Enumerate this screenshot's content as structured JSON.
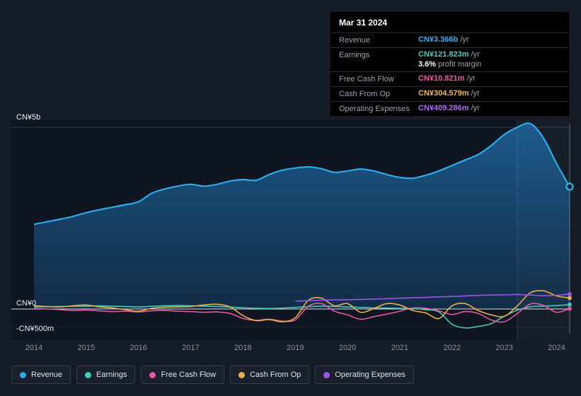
{
  "tooltip": {
    "date": "Mar 31 2024",
    "rows": [
      {
        "label": "Revenue",
        "value": "CN¥3.366b",
        "suffix": "/yr",
        "color": "#3fb1f0"
      },
      {
        "label": "Earnings",
        "value": "CN¥121.823m",
        "suffix": "/yr",
        "color": "#50cabb",
        "extra_value": "3.6%",
        "extra_label": "profit margin"
      },
      {
        "label": "Free Cash Flow",
        "value": "CN¥10.821m",
        "suffix": "/yr",
        "color": "#ea5ba6"
      },
      {
        "label": "Cash From Op",
        "value": "CN¥304.579m",
        "suffix": "/yr",
        "color": "#eebb55"
      },
      {
        "label": "Operating Expenses",
        "value": "CN¥409.286m",
        "suffix": "/yr",
        "color": "#b06cf5"
      }
    ]
  },
  "axes": {
    "y_labels": [
      "CN¥5b",
      "CN¥0",
      "-CN¥500m"
    ]
  },
  "legend": [
    {
      "label": "Revenue",
      "color": "#2fa9e8"
    },
    {
      "label": "Earnings",
      "color": "#45c7b5"
    },
    {
      "label": "Free Cash Flow",
      "color": "#e2579f"
    },
    {
      "label": "Cash From Op",
      "color": "#e6af4b"
    },
    {
      "label": "Operating Expenses",
      "color": "#9b55ea"
    }
  ],
  "chart_data": {
    "type": "area",
    "title": "Company earnings and revenue history",
    "x_unit": "year",
    "y_unit": "CN¥ millions",
    "x_range": [
      2014,
      2024.25
    ],
    "ylim": [
      -700,
      5400
    ],
    "grid": "horizontal",
    "legend_position": "bottom-left",
    "x_ticks": [
      2014,
      2015,
      2016,
      2017,
      2018,
      2019,
      2020,
      2021,
      2022,
      2023,
      2024
    ],
    "y_ticks": [
      {
        "label": "CN¥5b",
        "value": 5000
      },
      {
        "label": "CN¥0",
        "value": 0
      },
      {
        "label": "-CN¥500m",
        "value": -500
      }
    ],
    "x": [
      2014,
      2014.25,
      2014.5,
      2014.75,
      2015,
      2015.25,
      2015.5,
      2015.75,
      2016,
      2016.25,
      2016.5,
      2016.75,
      2017,
      2017.25,
      2017.5,
      2017.75,
      2018,
      2018.25,
      2018.5,
      2018.75,
      2019,
      2019.25,
      2019.5,
      2019.75,
      2020,
      2020.25,
      2020.5,
      2020.75,
      2021,
      2021.25,
      2021.5,
      2021.75,
      2022,
      2022.25,
      2022.5,
      2022.75,
      2023,
      2023.25,
      2023.5,
      2023.75,
      2024,
      2024.25
    ],
    "series": [
      {
        "name": "Revenue",
        "key": "revenue",
        "color": "#2fa9e8",
        "fill": true,
        "y": [
          2330,
          2400,
          2470,
          2550,
          2650,
          2730,
          2800,
          2870,
          2950,
          3180,
          3300,
          3380,
          3430,
          3380,
          3430,
          3520,
          3560,
          3540,
          3700,
          3820,
          3880,
          3910,
          3860,
          3760,
          3800,
          3850,
          3800,
          3700,
          3620,
          3600,
          3680,
          3800,
          3950,
          4100,
          4250,
          4500,
          4800,
          5000,
          5100,
          4700,
          4000,
          3366
        ]
      },
      {
        "name": "Earnings",
        "key": "earnings",
        "color": "#45c7b5",
        "fill": false,
        "y": [
          60,
          65,
          70,
          75,
          80,
          85,
          80,
          70,
          60,
          75,
          90,
          95,
          90,
          80,
          70,
          55,
          35,
          20,
          15,
          25,
          45,
          65,
          80,
          70,
          60,
          45,
          30,
          25,
          20,
          10,
          -20,
          -80,
          -420,
          -520,
          -480,
          -400,
          -200,
          -30,
          60,
          80,
          95,
          121.823
        ]
      },
      {
        "name": "Free Cash Flow",
        "key": "free-cash-flow",
        "color": "#e2579f",
        "fill": false,
        "y": [
          20,
          0,
          -20,
          -40,
          -30,
          -50,
          -70,
          -60,
          -80,
          -50,
          -40,
          -60,
          -70,
          -90,
          -80,
          -120,
          -260,
          -310,
          -280,
          -330,
          -300,
          80,
          150,
          -60,
          -160,
          -280,
          -210,
          -140,
          -60,
          30,
          20,
          -50,
          -150,
          -70,
          -120,
          -300,
          -350,
          -120,
          140,
          100,
          -90,
          10.821
        ]
      },
      {
        "name": "Cash From Op",
        "key": "cash-from-op",
        "color": "#e6af4b",
        "fill": false,
        "y": [
          90,
          70,
          60,
          90,
          110,
          60,
          30,
          -20,
          -60,
          20,
          50,
          60,
          70,
          110,
          130,
          60,
          -180,
          -320,
          -290,
          -350,
          -240,
          240,
          300,
          90,
          150,
          -90,
          10,
          150,
          110,
          -40,
          -110,
          -260,
          90,
          150,
          -40,
          -160,
          -200,
          90,
          450,
          500,
          360,
          304.579
        ]
      },
      {
        "name": "Operating Expenses",
        "key": "operating-expenses",
        "color": "#9b55ea",
        "fill": false,
        "x": [
          2019,
          2019.25,
          2019.5,
          2019.75,
          2020,
          2020.25,
          2020.5,
          2020.75,
          2021,
          2021.25,
          2021.5,
          2021.75,
          2022,
          2022.25,
          2022.5,
          2022.75,
          2023,
          2023.25,
          2023.5,
          2023.75,
          2024,
          2024.25
        ],
        "y": [
          220,
          230,
          245,
          250,
          255,
          265,
          275,
          285,
          295,
          310,
          320,
          335,
          345,
          360,
          375,
          385,
          390,
          400,
          385,
          365,
          380,
          409.286
        ]
      }
    ]
  }
}
